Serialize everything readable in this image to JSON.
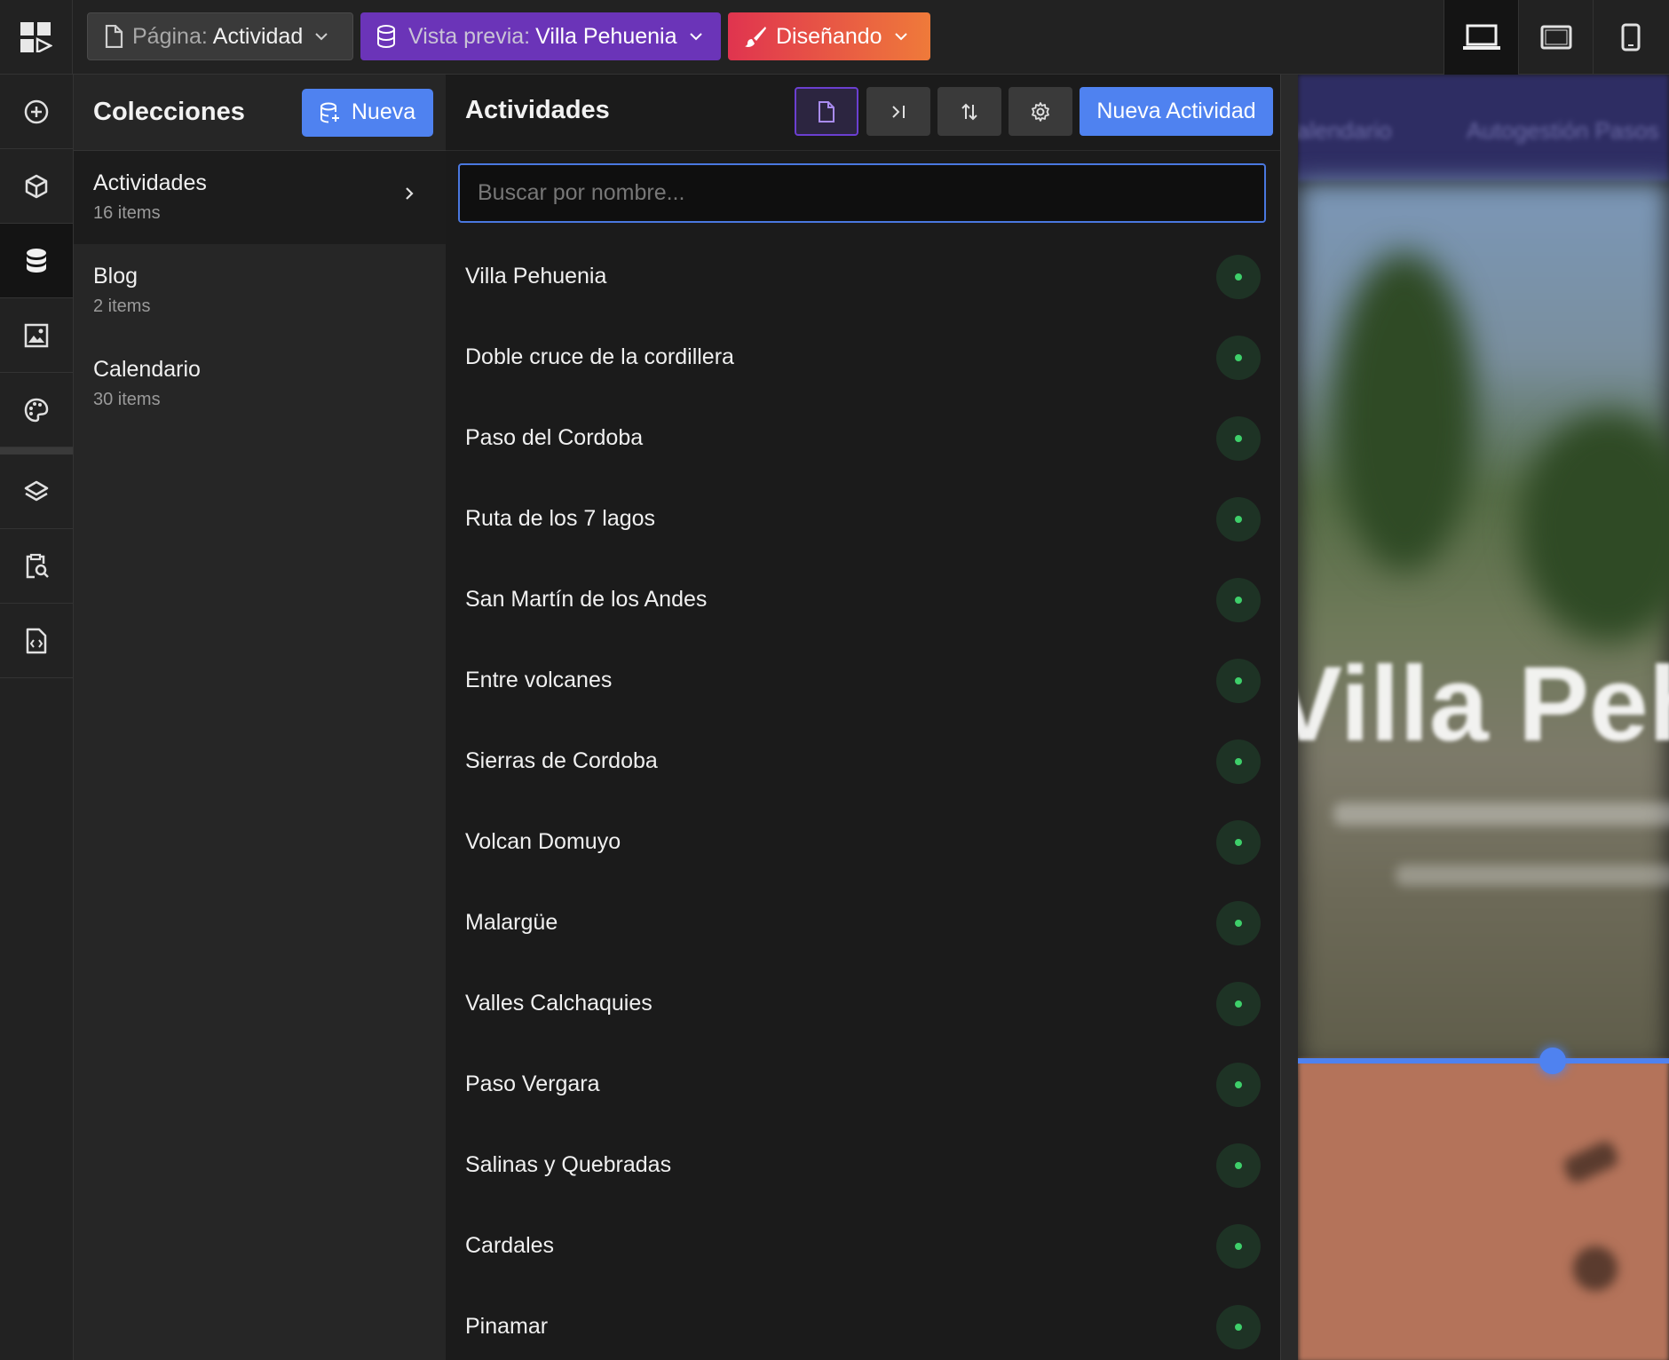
{
  "topbar": {
    "page_prefix": "Página:",
    "page_value": "Actividad",
    "preview_prefix": "Vista previa:",
    "preview_value": "Villa Pehuenia",
    "mode_label": "Diseñando"
  },
  "rail": {
    "items": [
      "add-icon",
      "box-icon",
      "database-icon",
      "image-icon",
      "palette-icon",
      "layers-icon",
      "page-search-icon",
      "code-file-icon"
    ],
    "active": "database-icon"
  },
  "collections": {
    "title": "Colecciones",
    "new_label": "Nueva",
    "items": [
      {
        "name": "Actividades",
        "count": "16 items",
        "active": true
      },
      {
        "name": "Blog",
        "count": "2 items",
        "active": false
      },
      {
        "name": "Calendario",
        "count": "30 items",
        "active": false
      }
    ]
  },
  "activities": {
    "title": "Actividades",
    "new_label": "Nueva Actividad",
    "search_placeholder": "Buscar por nombre...",
    "items": [
      "Villa Pehuenia",
      "Doble cruce de la cordillera",
      "Paso del Cordoba",
      "Ruta de los 7 lagos",
      "San Martín de los Andes",
      "Entre volcanes",
      "Sierras de Cordoba",
      "Volcan Domuyo",
      "Malargüe",
      "Valles Calchaquies",
      "Paso Vergara",
      "Salinas y Quebradas",
      "Cardales",
      "Pinamar"
    ],
    "status_color": "#3ecf6a"
  },
  "preview": {
    "nav_items": [
      "Calendario",
      "Autogestión Pasos"
    ],
    "hero_title": "Villa Pehuenia"
  },
  "colors": {
    "accent_blue": "#4f82f0",
    "preview_purple": "#6b34b8",
    "design_gradient_start": "#e0344f",
    "design_gradient_end": "#ef7a3a"
  }
}
